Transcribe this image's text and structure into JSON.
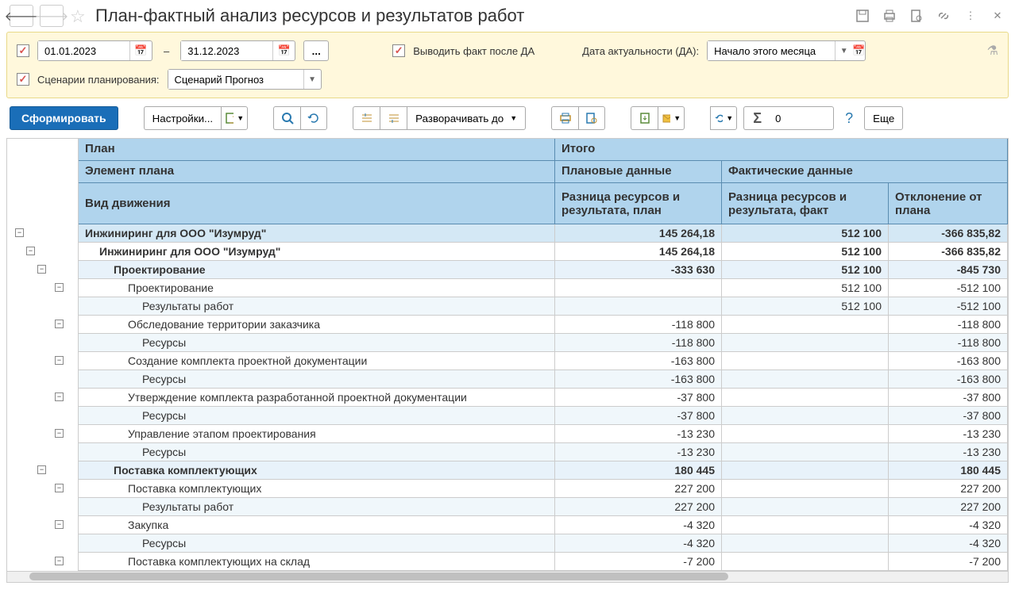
{
  "title": "План-фактный анализ ресурсов и результатов работ",
  "filters": {
    "date_from": "01.01.2023",
    "date_to": "31.12.2023",
    "show_fact_after_da": "Выводить факт после ДА",
    "da_label": "Дата актуальности (ДА):",
    "da_value": "Начало этого месяца",
    "scenario_label": "Сценарии планирования:",
    "scenario_value": "Сценарий Прогноз"
  },
  "toolbar": {
    "generate": "Сформировать",
    "settings": "Настройки...",
    "expand_to": "Разворачивать до",
    "more": "Еще",
    "sigma_value": "0"
  },
  "headers": {
    "plan": "План",
    "total": "Итого",
    "plan_element": "Элемент плана",
    "plan_data": "Плановые данные",
    "fact_data": "Фактические данные",
    "movement_type": "Вид движения",
    "diff_plan": "Разница ресурсов и результата, план",
    "diff_fact": "Разница ресурсов и результата, факт",
    "deviation": "Отклонение от плана"
  },
  "rows": [
    {
      "indent": 0,
      "label": "Инжиниринг для ООО \"Изумруд\"",
      "c1": "145 264,18",
      "c2": "512 100",
      "c3": "-366 835,82",
      "bold": true,
      "bg": "blue2",
      "exp": 10
    },
    {
      "indent": 1,
      "label": "Инжиниринг для ООО \"Изумруд\"",
      "c1": "145 264,18",
      "c2": "512 100",
      "c3": "-366 835,82",
      "bold": true,
      "bg": "",
      "exp": 24
    },
    {
      "indent": 2,
      "label": "Проектирование",
      "c1": "-333 630",
      "c2": "512 100",
      "c3": "-845 730",
      "bold": true,
      "bg": "blue",
      "exp": 38
    },
    {
      "indent": 3,
      "label": "Проектирование",
      "c1": "",
      "c2": "512 100",
      "c3": "-512 100",
      "bold": false,
      "bg": "",
      "exp": 60
    },
    {
      "indent": 4,
      "label": "Результаты работ",
      "c1": "",
      "c2": "512 100",
      "c3": "-512 100",
      "bold": false,
      "bg": "stripe",
      "exp": null
    },
    {
      "indent": 3,
      "label": "Обследование территории заказчика",
      "c1": "-118 800",
      "c2": "",
      "c3": "-118 800",
      "bold": false,
      "bg": "",
      "exp": 60
    },
    {
      "indent": 4,
      "label": "Ресурсы",
      "c1": "-118 800",
      "c2": "",
      "c3": "-118 800",
      "bold": false,
      "bg": "stripe",
      "exp": null
    },
    {
      "indent": 3,
      "label": "Создание комплекта проектной документации",
      "c1": "-163 800",
      "c2": "",
      "c3": "-163 800",
      "bold": false,
      "bg": "",
      "exp": 60
    },
    {
      "indent": 4,
      "label": "Ресурсы",
      "c1": "-163 800",
      "c2": "",
      "c3": "-163 800",
      "bold": false,
      "bg": "stripe",
      "exp": null
    },
    {
      "indent": 3,
      "label": "Утверждение комплекта разработанной проектной документации",
      "c1": "-37 800",
      "c2": "",
      "c3": "-37 800",
      "bold": false,
      "bg": "",
      "exp": 60
    },
    {
      "indent": 4,
      "label": "Ресурсы",
      "c1": "-37 800",
      "c2": "",
      "c3": "-37 800",
      "bold": false,
      "bg": "stripe",
      "exp": null
    },
    {
      "indent": 3,
      "label": "Управление этапом проектирования",
      "c1": "-13 230",
      "c2": "",
      "c3": "-13 230",
      "bold": false,
      "bg": "",
      "exp": 60
    },
    {
      "indent": 4,
      "label": "Ресурсы",
      "c1": "-13 230",
      "c2": "",
      "c3": "-13 230",
      "bold": false,
      "bg": "stripe",
      "exp": null
    },
    {
      "indent": 2,
      "label": "Поставка комплектующих",
      "c1": "180 445",
      "c2": "",
      "c3": "180 445",
      "bold": true,
      "bg": "blue",
      "exp": 38
    },
    {
      "indent": 3,
      "label": "Поставка комплектующих",
      "c1": "227 200",
      "c2": "",
      "c3": "227 200",
      "bold": false,
      "bg": "",
      "exp": 60
    },
    {
      "indent": 4,
      "label": "Результаты работ",
      "c1": "227 200",
      "c2": "",
      "c3": "227 200",
      "bold": false,
      "bg": "stripe",
      "exp": null
    },
    {
      "indent": 3,
      "label": "Закупка",
      "c1": "-4 320",
      "c2": "",
      "c3": "-4 320",
      "bold": false,
      "bg": "",
      "exp": 60
    },
    {
      "indent": 4,
      "label": "Ресурсы",
      "c1": "-4 320",
      "c2": "",
      "c3": "-4 320",
      "bold": false,
      "bg": "stripe",
      "exp": null
    },
    {
      "indent": 3,
      "label": "Поставка комплектующих на склад",
      "c1": "-7 200",
      "c2": "",
      "c3": "-7 200",
      "bold": false,
      "bg": "",
      "exp": 60
    }
  ]
}
